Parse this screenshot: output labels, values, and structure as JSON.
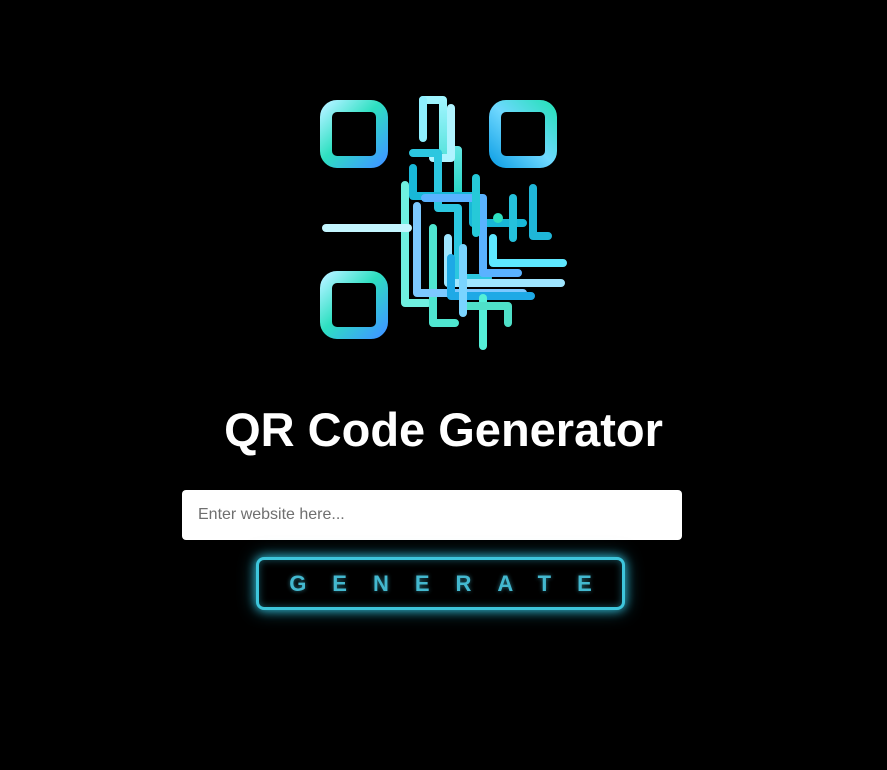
{
  "logo": {
    "icon": "qr-code-icon",
    "gradient_colors": [
      "#2ee0c0",
      "#4fa8ff",
      "#a0f0ff",
      "#12b8d8"
    ]
  },
  "header": {
    "title": "QR Code Generator"
  },
  "form": {
    "input_value": "",
    "input_placeholder": "Enter website here...",
    "button_label": "GENERATE"
  },
  "colors": {
    "background": "#000000",
    "accent": "#3ec6dc",
    "title": "#ffffff"
  }
}
